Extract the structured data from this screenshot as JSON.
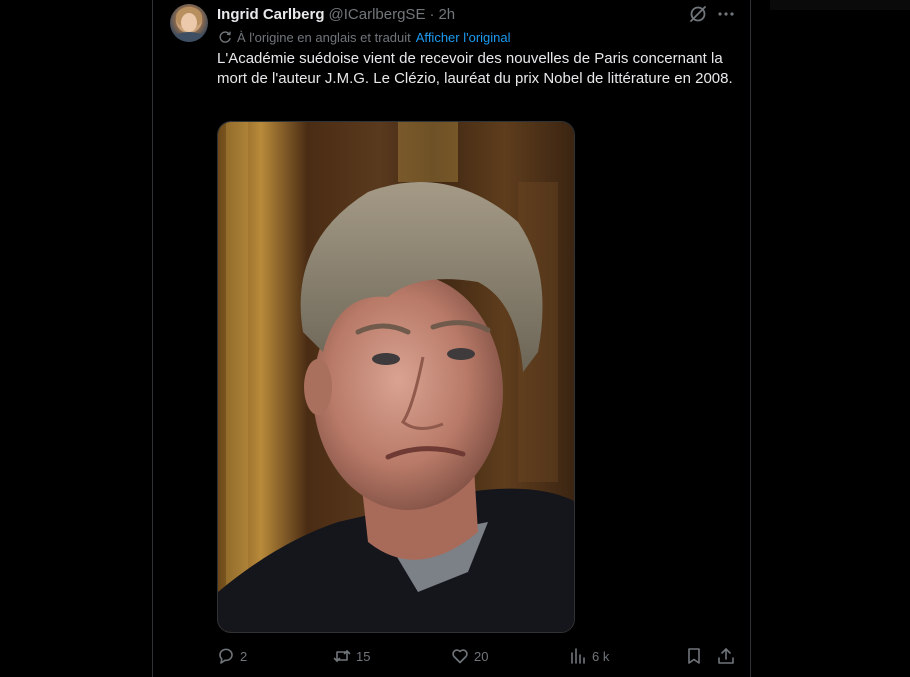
{
  "author": {
    "name": "Ingrid Carlberg",
    "handle": "@ICarlbergSE",
    "separator": "·",
    "time": "2h"
  },
  "translation": {
    "note": "À l'origine en anglais et traduit",
    "show_original": "Afficher l'original"
  },
  "tweet": {
    "text": "L'Académie suédoise vient de recevoir des nouvelles de Paris concernant la mort de l'auteur J.M.G. Le Clézio, lauréat du prix Nobel de littérature en 2008."
  },
  "actions": {
    "replies": "2",
    "reposts": "15",
    "likes": "20",
    "views": "6 k"
  },
  "colors": {
    "background": "#000000",
    "text": "#e7e9ea",
    "muted": "#71767b",
    "link": "#1d9bf0",
    "border": "#2f3336"
  },
  "icons": {
    "grok": "grok-icon",
    "more": "more-icon",
    "translate": "translate-icon",
    "reply": "reply-icon",
    "repost": "repost-icon",
    "like": "heart-icon",
    "views": "views-icon",
    "bookmark": "bookmark-icon",
    "share": "share-icon"
  }
}
